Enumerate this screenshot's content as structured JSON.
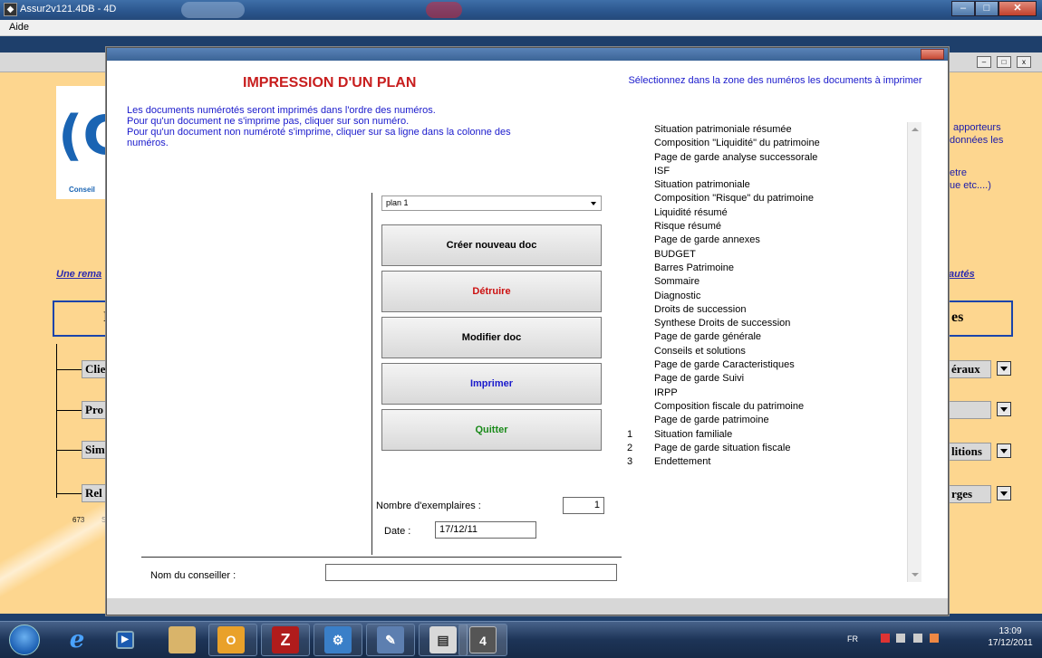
{
  "window": {
    "title": "Assur2v121.4DB - 4D",
    "menu": "Aide"
  },
  "background_app": {
    "logo_text": "Conseil",
    "link_left": "Une rema",
    "link_right": "autés",
    "right_text_1": "apporteurs",
    "right_text_2": "données les",
    "right_text_3": "etre",
    "right_text_4": "ue etc....)",
    "box_left_letter": "I",
    "box_right_text": "es",
    "buttons_left": [
      "Clie",
      "Pro",
      "Sim",
      "Rel"
    ],
    "buttons_right": [
      "éraux",
      "",
      "litions",
      "rges"
    ],
    "footer_num": "673",
    "footer_letter": "S"
  },
  "dialog": {
    "title": "IMPRESSION D'UN PLAN",
    "info_lines": [
      "Les documents numérotés seront imprimés dans l'ordre des numéros.",
      "Pour qu'un document ne s'imprime pas, cliquer sur son numéro.",
      "Pour qu'un document non numéroté s'imprime, cliquer sur sa ligne dans la colonne des",
      "numéros."
    ],
    "hint": "Sélectionnez dans la zone des numéros les documents à imprimer",
    "plan_select": "plan 1",
    "buttons": {
      "create": "Créer nouveau doc",
      "delete": "Détruire",
      "modify": "Modifier doc",
      "print": "Imprimer",
      "quit": "Quitter"
    },
    "colors": {
      "create": "#000000",
      "delete": "#cc1111",
      "modify": "#000000",
      "print": "#1a1acc",
      "quit": "#1a8a1a"
    },
    "copies_label": "Nombre d'exemplaires :",
    "copies_value": "1",
    "date_label": "Date :",
    "date_value": "17/12/11",
    "advisor_label": "Nom du conseiller :",
    "advisor_value": "",
    "documents": [
      {
        "num": "",
        "name": "Situation patrimoniale résumée"
      },
      {
        "num": "",
        "name": "Composition \"Liquidité\" du patrimoine"
      },
      {
        "num": "",
        "name": "Page de garde analyse successorale"
      },
      {
        "num": "",
        "name": "ISF"
      },
      {
        "num": "",
        "name": "Situation patrimoniale"
      },
      {
        "num": "",
        "name": "Composition \"Risque\" du patrimoine"
      },
      {
        "num": "",
        "name": "Liquidité résumé"
      },
      {
        "num": "",
        "name": "Risque résumé"
      },
      {
        "num": "",
        "name": "Page de garde annexes"
      },
      {
        "num": "",
        "name": "BUDGET"
      },
      {
        "num": "",
        "name": "Barres Patrimoine"
      },
      {
        "num": "",
        "name": "Sommaire"
      },
      {
        "num": "",
        "name": "Diagnostic"
      },
      {
        "num": "",
        "name": "Droits de succession"
      },
      {
        "num": "",
        "name": "Synthese Droits de succession"
      },
      {
        "num": "",
        "name": "Page de garde générale"
      },
      {
        "num": "",
        "name": "Conseils et solutions"
      },
      {
        "num": "",
        "name": "Page de garde Caracteristiques"
      },
      {
        "num": "",
        "name": "Page de garde Suivi"
      },
      {
        "num": "",
        "name": "IRPP"
      },
      {
        "num": "",
        "name": "Composition fiscale du patrimoine"
      },
      {
        "num": "",
        "name": "Page de garde patrimoine"
      },
      {
        "num": "1",
        "name": "Situation familiale"
      },
      {
        "num": "2",
        "name": "Page de garde situation fiscale"
      },
      {
        "num": "3",
        "name": "Endettement"
      }
    ]
  },
  "taskbar": {
    "lang": "FR",
    "time": "13:09",
    "date": "17/12/2011",
    "icons": [
      "ie-icon",
      "media-player-icon",
      "explorer-icon",
      "outlook-icon",
      "filezilla-icon",
      "tool-icon",
      "paint-icon",
      "word-icon",
      "4d-icon"
    ]
  }
}
